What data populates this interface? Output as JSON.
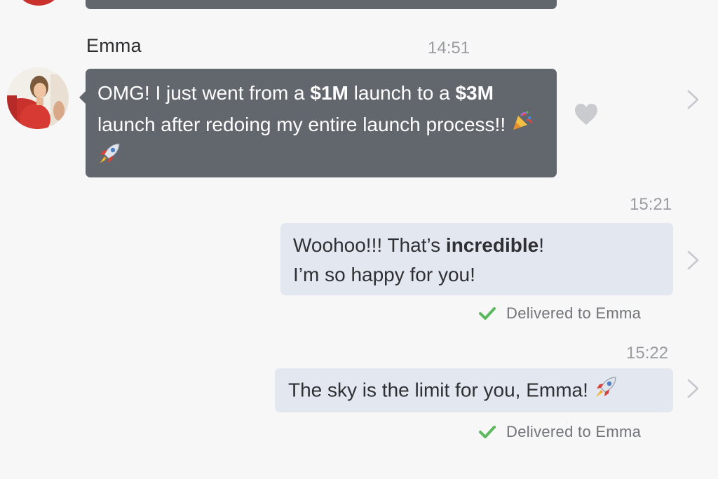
{
  "thread": {
    "incoming": {
      "sender": "Emma",
      "time": "14:51",
      "text_part1": "OMG! I just went from a ",
      "amount1": "$1M",
      "text_part2": " launch to a ",
      "amount2": "$3M",
      "text_part3": " launch after redoing my entire launch process!!",
      "emojis": [
        "party-popper",
        "rocket"
      ]
    },
    "outgoing1": {
      "time": "15:21",
      "line1_prefix": "Woohoo!!! That’s ",
      "line1_bold": "incredible",
      "line1_suffix": "!",
      "line2": "I’m so happy for you!",
      "status": "Delivered to Emma"
    },
    "outgoing2": {
      "time": "15:22",
      "text": "The sky is the limit for you, Emma!",
      "emojis": [
        "rocket"
      ],
      "status": "Delivered to Emma"
    }
  },
  "icons": {
    "like": "heart-icon",
    "more": "chevron-right-icon",
    "delivered": "check-icon"
  },
  "colors": {
    "incoming_bubble": "#62666d",
    "outgoing_bubble": "#e3e7ef",
    "background": "#f7f7f8",
    "check": "#5cb85c",
    "muted": "#9a9ca1"
  }
}
